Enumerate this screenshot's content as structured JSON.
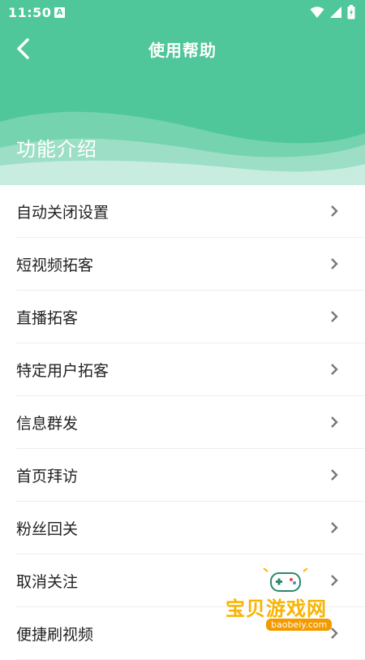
{
  "status_bar": {
    "time": "11:50",
    "notification_badge": "A",
    "icons": [
      "wifi-icon",
      "signal-icon",
      "battery-icon"
    ]
  },
  "header": {
    "title": "使用帮助",
    "section_title": "功能介绍",
    "back_icon": "back-arrow-icon"
  },
  "menu": {
    "items": [
      {
        "label": "自动关闭设置"
      },
      {
        "label": "短视频拓客"
      },
      {
        "label": "直播拓客"
      },
      {
        "label": "特定用户拓客"
      },
      {
        "label": "信息群发"
      },
      {
        "label": "首页拜访"
      },
      {
        "label": "粉丝回关"
      },
      {
        "label": "取消关注"
      },
      {
        "label": "便捷刷视频"
      }
    ]
  },
  "watermark": {
    "text": "宝贝游戏网",
    "url": "baobeiy.com"
  },
  "colors": {
    "primary": "#4fc79a",
    "wave_light": "#7fd6b5",
    "wave_lightest": "#c9ece0",
    "divider": "#eeeeee",
    "text": "#222222",
    "chevron": "#777777"
  }
}
